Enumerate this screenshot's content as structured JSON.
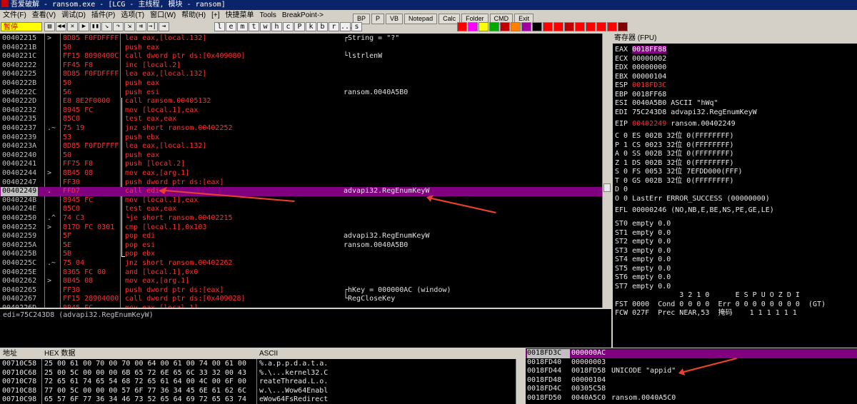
{
  "window": {
    "title": "吾爱破解 - ransom.exe - [LCG - 主线程, 模块 - ransom]"
  },
  "menu": [
    "文件(F)",
    "查看(V)",
    "调试(D)",
    "插件(P)",
    "选项(T)",
    "窗口(W)",
    "帮助(H)",
    "[+]",
    "快捷菜单",
    "Tools",
    "BreakPoint->"
  ],
  "cmd_buttons": [
    "BP",
    "P",
    "VB",
    "Notepad",
    "Calc",
    "Folder",
    "CMD",
    "Exit"
  ],
  "toolbar": {
    "status": "暂停",
    "icons": [
      "folder-open-icon",
      "rewind-icon",
      "close-icon",
      "play-icon",
      "pause-icon",
      "step-into-icon",
      "step-over-icon",
      "trace-into-icon",
      "trace-over-icon",
      "execute-till-return-icon",
      "goto-icon"
    ],
    "letters": [
      "l",
      "e",
      "m",
      "t",
      "w",
      "h",
      "c",
      "P",
      "k",
      "b",
      "r",
      "...",
      "s"
    ],
    "color_swatches": [
      "#ff0000",
      "#ff00ff",
      "#ffff00",
      "#00aa00",
      "#c00000",
      "#ff8000",
      "#a000a0",
      "#000000",
      "#ff0000",
      "#ff0000",
      "#c00000",
      "#ff0000",
      "#ff0000",
      "#ff0000",
      "#ff0000",
      "#800000"
    ]
  },
  "disasm": {
    "rows": [
      {
        "addr": "00402215",
        "mk": ">",
        "hex": "8D85 F0FDFFFF",
        "ins": "lea eax,[local.132]",
        "cm": "┌String = \"?\""
      },
      {
        "addr": "0040221B",
        "mk": "",
        "hex": "50",
        "ins": "push eax",
        "cm": ""
      },
      {
        "addr": "0040221C",
        "mk": "",
        "hex": "FF15 8090400C",
        "ins": "call dword ptr ds:[0x409080]",
        "cm": "└lstrlenW"
      },
      {
        "addr": "00402222",
        "mk": "",
        "hex": "FF45 F8",
        "ins": "inc [local.2]",
        "cm": ""
      },
      {
        "addr": "00402225",
        "mk": "",
        "hex": "8D85 F0FDFFFF",
        "ins": "lea eax,[local.132]",
        "cm": ""
      },
      {
        "addr": "0040222B",
        "mk": "",
        "hex": "50",
        "ins": "push eax",
        "cm": ""
      },
      {
        "addr": "0040222C",
        "mk": "",
        "hex": "56",
        "ins": "push esi",
        "cm": "ransom.0040A5B0"
      },
      {
        "addr": "0040222D",
        "mk": "",
        "hex": "E8 8E2F0000",
        "ins": "call ransom.00405132",
        "cm": ""
      },
      {
        "addr": "00402232",
        "mk": "",
        "hex": "8945 FC",
        "ins": "mov [local.1],eax",
        "cm": ""
      },
      {
        "addr": "00402235",
        "mk": "",
        "hex": "85C0",
        "ins": "test eax,eax",
        "cm": ""
      },
      {
        "addr": "00402237",
        "mk": ".~",
        "hex": "75 19",
        "ins": "jnz short ransom.00402252",
        "cm": ""
      },
      {
        "addr": "00402239",
        "mk": "",
        "hex": "53",
        "ins": "push ebx",
        "cm": ""
      },
      {
        "addr": "0040223A",
        "mk": "",
        "hex": "8D85 F0FDFFFF",
        "ins": "lea eax,[local.132]",
        "cm": ""
      },
      {
        "addr": "00402240",
        "mk": "",
        "hex": "50",
        "ins": "push eax",
        "cm": ""
      },
      {
        "addr": "00402241",
        "mk": "",
        "hex": "FF75 F8",
        "ins": "push [local.2]",
        "cm": ""
      },
      {
        "addr": "00402244",
        "mk": ">",
        "hex": "8B45 08",
        "ins": "mov eax,[arg.1]",
        "cm": ""
      },
      {
        "addr": "00402247",
        "mk": "",
        "hex": "FF30",
        "ins": "push dword ptr ds:[eax]",
        "cm": ""
      },
      {
        "addr": "00402249",
        "mk": ".",
        "hex": "FFD7",
        "ins": "call edi",
        "cm": "advapi32.RegEnumKeyW",
        "sel": true
      },
      {
        "addr": "0040224B",
        "mk": "",
        "hex": "8945 FC",
        "ins": "mov [local.1],eax",
        "cm": ""
      },
      {
        "addr": "0040224E",
        "mk": "",
        "hex": "85C0",
        "ins": "test eax,eax",
        "cm": ""
      },
      {
        "addr": "00402250",
        "mk": ".^",
        "hex": "74 C3",
        "ins": "└je short ransom.00402215",
        "cm": ""
      },
      {
        "addr": "00402252",
        "mk": ">",
        "hex": "817D FC 0301",
        "ins": "cmp [local.1],0x103",
        "cm": ""
      },
      {
        "addr": "00402259",
        "mk": "",
        "hex": "5F",
        "ins": "pop edi",
        "cm": "advapi32.RegEnumKeyW"
      },
      {
        "addr": "0040225A",
        "mk": "",
        "hex": "5E",
        "ins": "pop esi",
        "cm": "ransom.0040A5B0"
      },
      {
        "addr": "0040225B",
        "mk": "",
        "hex": "5B",
        "ins": "pop ebx",
        "cm": ""
      },
      {
        "addr": "0040225C",
        "mk": ".~",
        "hex": "75 04",
        "ins": "jnz short ransom.00402262",
        "cm": ""
      },
      {
        "addr": "0040225E",
        "mk": "",
        "hex": "8365 FC 00",
        "ins": "and [local.1],0x0",
        "cm": ""
      },
      {
        "addr": "00402262",
        "mk": ">",
        "hex": "8B45 08",
        "ins": "mov eax,[arg.1]",
        "cm": ""
      },
      {
        "addr": "00402265",
        "mk": "",
        "hex": "FF30",
        "ins": "push dword ptr ds:[eax]",
        "cm": "┌hKey = 000000AC (window)"
      },
      {
        "addr": "00402267",
        "mk": "",
        "hex": "FF15 28904000",
        "ins": "call dword ptr ds:[0x409028]",
        "cm": "└RegCloseKey"
      },
      {
        "addr": "0040226D",
        "mk": "",
        "hex": "8B45 FC",
        "ins": "mov eax,[local.1]",
        "cm": ""
      }
    ]
  },
  "info_line": "edi=75C243D8 (advapi32.RegEnumKeyW)",
  "registers": {
    "title": "寄存器 (FPU)",
    "gp": [
      {
        "n": "EAX",
        "v": "0018FF88",
        "c": "",
        "hl": true
      },
      {
        "n": "ECX",
        "v": "00000002",
        "c": ""
      },
      {
        "n": "EDX",
        "v": "00000000",
        "c": ""
      },
      {
        "n": "EBX",
        "v": "00000104",
        "c": ""
      },
      {
        "n": "ESP",
        "v": "0018FD3C",
        "c": "",
        "red": true
      },
      {
        "n": "EBP",
        "v": "0018FF68",
        "c": ""
      },
      {
        "n": "ESI",
        "v": "0040A5B0",
        "c": "ASCII \"hWq\""
      },
      {
        "n": "EDI",
        "v": "75C243D8",
        "c": "advapi32.RegEnumKeyW"
      }
    ],
    "eip": {
      "n": "EIP",
      "v": "00402249",
      "c": "ransom.00402249"
    },
    "flags": [
      "C 0  ES 002B 32位 0(FFFFFFFF)",
      "P 1  CS 0023 32位 0(FFFFFFFF)",
      "A 0  SS 002B 32位 0(FFFFFFFF)",
      "Z 1  DS 002B 32位 0(FFFFFFFF)",
      "S 0  FS 0053 32位 7EFDD000(FFF)",
      "T 0  GS 002B 32位 0(FFFFFFFF)",
      "D 0",
      "O 0  LastErr ERROR_SUCCESS (00000000)"
    ],
    "efl": "EFL 00000246 (NO,NB,E,BE,NS,PE,GE,LE)",
    "st": [
      "ST0 empty 0.0",
      "ST1 empty 0.0",
      "ST2 empty 0.0",
      "ST3 empty 0.0",
      "ST4 empty 0.0",
      "ST5 empty 0.0",
      "ST6 empty 0.0",
      "ST7 empty 0.0"
    ],
    "fpu_hdr": "               3 2 1 0      E S P U O Z D I",
    "fst": "FST 0000  Cond 0 0 0 0  Err 0 0 0 0 0 0 0 0  (GT)",
    "fcw": "FCW 027F  Prec NEAR,53  掩码    1 1 1 1 1 1"
  },
  "dump": {
    "headers": {
      "addr": "地址",
      "hex": "HEX 数据",
      "ascii": "ASCII"
    },
    "rows": [
      {
        "a": "00710C58",
        "h": "25 00 61 00 70 00 70 00 64 00 61 00 74 00 61 00",
        "s": "%.a.p.p.d.a.t.a."
      },
      {
        "a": "00710C68",
        "h": "25 00 5C 00 00 00 6B 65 72 6E 65 6C 33 32 00 43",
        "s": "%.\\...kernel32.C"
      },
      {
        "a": "00710C78",
        "h": "72 65 61 74 65 54 68 72 65 61 64 00 4C 00 6F 00",
        "s": "reateThread.L.o."
      },
      {
        "a": "00710C88",
        "h": "77 00 5C 00 00 00 57 6F 77 36 34 45 6E 61 62 6C",
        "s": "w.\\...Wow64Enabl"
      },
      {
        "a": "00710C98",
        "h": "65 57 6F 77 36 34 46 73 52 65 64 69 72 65 63 74",
        "s": "eWow64FsRedirect"
      }
    ]
  },
  "stack": {
    "rows": [
      {
        "a": "0018FD3C",
        "v": "000000AC",
        "c": "",
        "hi": true
      },
      {
        "a": "0018FD40",
        "v": "00000003",
        "c": ""
      },
      {
        "a": "0018FD44",
        "v": "0018FD58",
        "c": "UNICODE \"appid\""
      },
      {
        "a": "0018FD48",
        "v": "00000104",
        "c": ""
      },
      {
        "a": "0018FD4C",
        "v": "00305C58",
        "c": ""
      },
      {
        "a": "0018FD50",
        "v": "0040A5C0",
        "c": "ransom.0040A5C0"
      }
    ]
  }
}
